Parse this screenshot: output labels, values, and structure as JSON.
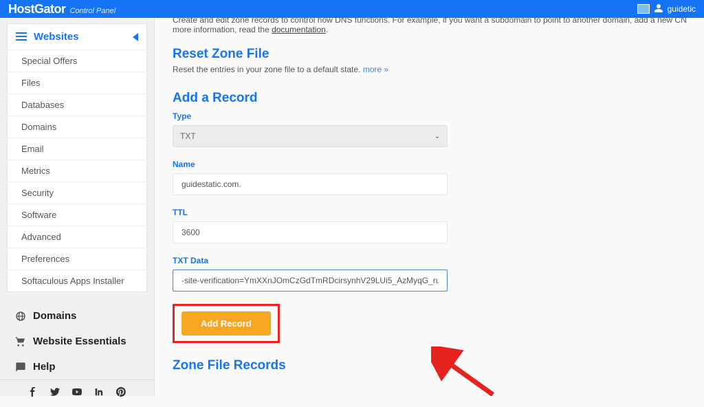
{
  "header": {
    "brand": "HostGator",
    "subtitle": "Control Panel",
    "username": "guidetic"
  },
  "sidebar": {
    "active_section": "Websites",
    "items": [
      "Special Offers",
      "Files",
      "Databases",
      "Domains",
      "Email",
      "Metrics",
      "Security",
      "Software",
      "Advanced",
      "Preferences",
      "Softaculous Apps Installer"
    ],
    "categories": {
      "domains": "Domains",
      "essentials": "Website Essentials",
      "help": "Help"
    }
  },
  "main": {
    "intro_cut": "Create and edit zone records to control how DNS functions. For example, if you want a subdomain to point to another domain, add a new CNAME r",
    "intro_line2_prefix": "more information, read the ",
    "intro_doc_link": "documentation",
    "intro_line2_suffix": ".",
    "reset": {
      "title": "Reset Zone File",
      "desc": "Reset the entries in your zone file to a default state.",
      "more": "more »"
    },
    "add": {
      "title": "Add a Record",
      "type_label": "Type",
      "type_value": "TXT",
      "name_label": "Name",
      "name_value": "guidestatic.com.",
      "ttl_label": "TTL",
      "ttl_value": "3600",
      "txt_label": "TXT Data",
      "txt_value": "-site-verification=YmXXnJOmCzGdTmRDcirsynhV29LUi5_AzMyqG_ruUKM",
      "button": "Add Record"
    },
    "zone_records_title": "Zone File Records"
  }
}
